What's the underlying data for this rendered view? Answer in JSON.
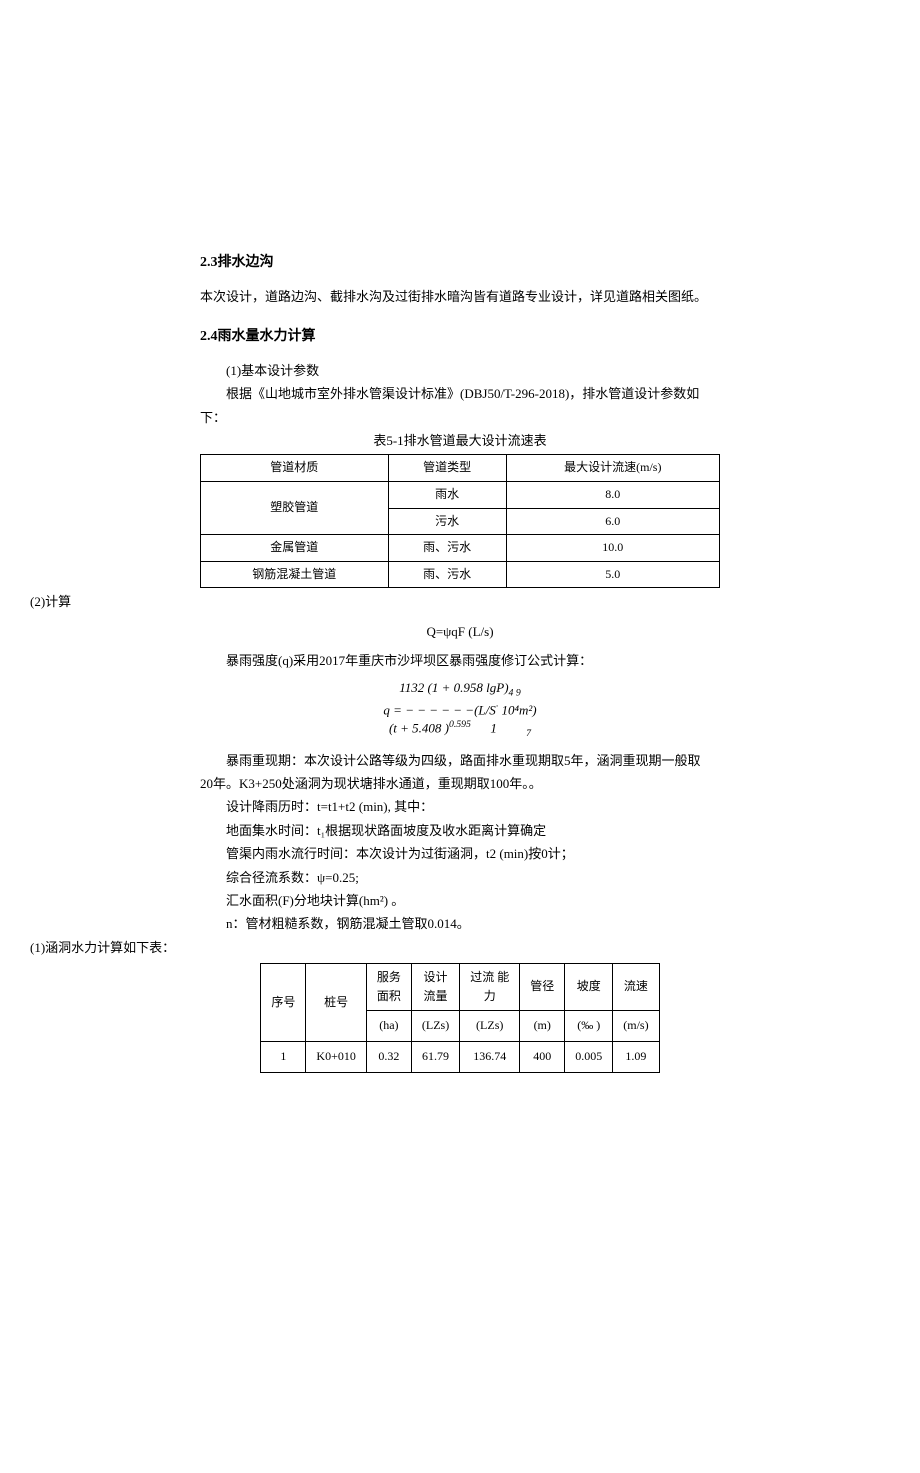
{
  "s23": {
    "title": "2.3排水边沟",
    "p1": "本次设计，道路边沟、截排水沟及过街排水暗沟皆有道路专业设计，详见道路相关图纸。"
  },
  "s24": {
    "title": "2.4雨水量水力计算",
    "p1": "(1)基本设计参数",
    "p2": "根据《山地城市室外排水管渠设计标准》(DBJ50/T-296-2018)，排水管道设计参数如",
    "p2b": "下：",
    "tableCaption": "表5-1排水管道最大设计流速表",
    "th1": "管道材质",
    "th2": "管道类型",
    "th3": "最大设计流速(m/s)",
    "r1c1": "塑胶管道",
    "r1c2": "雨水",
    "r1c3": "8.0",
    "r2c2": "污水",
    "r2c3": "6.0",
    "r3c1": "金属管道",
    "r3c2": "雨、污水",
    "r3c3": "10.0",
    "r4c1": "钢筋混凝土管道",
    "r4c2": "雨、污水",
    "r4c3": "5.0",
    "calcLabel": "(2)计算",
    "formula1": "Q=ψqF (L/s)",
    "p3": "暴雨强度(q)采用2017年重庆市沙坪坝区暴雨强度修订公式计算：",
    "f2a": "1132 (1 + 0.958 lgP)",
    "f2a_exp": "4 9",
    "f2b_q": "q",
    "f2b_eq": " = − − − − − −(L/S",
    "f2b_dot": "·",
    "f2b_unit": " 10⁴m²)",
    "f2c": "(t + 5.408 )",
    "f2c_exp1": "0.595",
    "f2c_tail": "1",
    "f2c_ex2": "7",
    "p4": "暴雨重现期：本次设计公路等级为四级，路面排水重现期取5年，涵洞重现期一般取",
    "p4b": "20年。K3+250处涵洞为现状塘排水通道，重现期取100年。。",
    "p5": "设计降雨历时：t=t1+t2 (min), 其中：",
    "p6": "地面集水时间：t₁根据现状路面坡度及收水距离计算确定",
    "p7": "管渠内雨水流行时间：本次设计为过街涵洞，t2 (min)按0计；",
    "p8": "综合径流系数：ψ=0.25;",
    "p9": "汇水面积(F)分地块计算(hm²) 。",
    "p10": "n：管材粗糙系数，钢筋混凝土管取0.014。",
    "calcTableLabel": "(1)涵洞水力计算如下表：",
    "ct": {
      "h1": "序号",
      "h2": "桩号",
      "h3a": "服务",
      "h3b": "面积",
      "h3c": "(ha)",
      "h4a": "设计",
      "h4b": "流量",
      "h4c": "(LZs)",
      "h5a": "过流 能",
      "h5b": "力",
      "h5c": "(LZs)",
      "h6a": "管径",
      "h6c": "(m)",
      "h7a": "坡度",
      "h7c": "(‰ )",
      "h8a": "流速",
      "h8c": "(m/s)",
      "r1c1": "1",
      "r1c2": "K0+010",
      "r1c3": "0.32",
      "r1c4": "61.79",
      "r1c5": "136.74",
      "r1c6": "400",
      "r1c7": "0.005",
      "r1c8": "1.09"
    }
  }
}
